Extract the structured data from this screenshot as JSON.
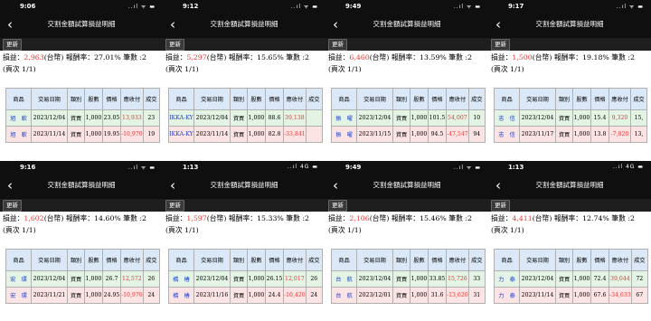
{
  "common": {
    "title": "交割金額試算損益明細",
    "back_icon": "chevron-left-icon",
    "refresh_label": "更新",
    "pl_label": "損益：",
    "ccy_label": "(台幣)",
    "roi_label": " 報酬率：",
    "count_label": " 筆數 :",
    "page_label": "(頁次 1/1)",
    "headers": [
      "商品",
      "交易日期",
      "類別",
      "股數",
      "價格",
      "應收付",
      "成交"
    ]
  },
  "panels": [
    {
      "time": "9:06",
      "signal": "..ıl ᯤ ▬",
      "pl": "2,963",
      "roi": "27.01%",
      "count": "2",
      "rows": [
        {
          "prod": "旭　軟",
          "date": "2023/12/04",
          "type": "資買",
          "qty": "1,000",
          "price": "23.05",
          "amt": "13,933",
          "last": "23"
        },
        {
          "prod": "旭　軟",
          "date": "2023/11/14",
          "type": "資買",
          "qty": "1,000",
          "price": "19.95",
          "amt": "-10,970",
          "last": "19"
        }
      ]
    },
    {
      "time": "9:12",
      "signal": "..ıl ᯤ ▬",
      "pl": "5,297",
      "roi": "15.65%",
      "count": "2",
      "rows": [
        {
          "prod": "IKKA-KY",
          "date": "2023/12/04",
          "type": "資買",
          "qty": "1,000",
          "price": "88.6",
          "amt": "39,138",
          "last": ""
        },
        {
          "prod": "IKKA-KY",
          "date": "2023/11/14",
          "type": "資買",
          "qty": "1,000",
          "price": "82.8",
          "amt": "-33,841",
          "last": ""
        }
      ]
    },
    {
      "time": "9:49",
      "signal": "..ıl ᯤ ▬",
      "pl": "6,460",
      "roi": "13.59%",
      "count": "2",
      "rows": [
        {
          "prod": "振　曜",
          "date": "2023/12/04",
          "type": "資買",
          "qty": "1,000",
          "price": "101.5",
          "amt": "54,007",
          "last": "10"
        },
        {
          "prod": "振　曜",
          "date": "2023/11/15",
          "type": "資買",
          "qty": "1,000",
          "price": "94.5",
          "amt": "-47,547",
          "last": "94"
        }
      ]
    },
    {
      "time": "9:17",
      "signal": "..ıl ᯤ ▬",
      "pl": "1,500",
      "roi": "19.18%",
      "count": "2",
      "rows": [
        {
          "prod": "志　信",
          "date": "2023/12/04",
          "type": "資買",
          "qty": "1,000",
          "price": "15.4",
          "amt": "9,320",
          "last": "15,"
        },
        {
          "prod": "志　信",
          "date": "2023/11/17",
          "type": "資買",
          "qty": "1,000",
          "price": "13.8",
          "amt": "-7,820",
          "last": "13,"
        }
      ]
    },
    {
      "time": "9:16",
      "signal": "..ıl ᯤ ▬",
      "pl": "1,602",
      "roi": "14.60%",
      "count": "2",
      "rows": [
        {
          "prod": "宏　環",
          "date": "2023/12/04",
          "type": "資買",
          "qty": "1,000",
          "price": "26.7",
          "amt": "12,572",
          "last": "26"
        },
        {
          "prod": "宏　環",
          "date": "2023/11/21",
          "type": "資買",
          "qty": "1,000",
          "price": "24.95",
          "amt": "-10,970",
          "last": "24"
        }
      ]
    },
    {
      "time": "1:13",
      "signal": "..ıl 4G ▬",
      "pl": "1,597",
      "roi": "15.33%",
      "count": "2",
      "rows": [
        {
          "prod": "橋　椿",
          "date": "2023/12/04",
          "type": "資買",
          "qty": "1,000",
          "price": "26.15",
          "amt": "12,017",
          "last": "26"
        },
        {
          "prod": "橋　椿",
          "date": "2023/11/16",
          "type": "資買",
          "qty": "1,000",
          "price": "24.4",
          "amt": "-10,420",
          "last": "24"
        }
      ]
    },
    {
      "time": "9:49",
      "signal": "..ıl ᯤ ▬",
      "pl": "2,106",
      "roi": "15.46%",
      "count": "2",
      "rows": [
        {
          "prod": "台　航",
          "date": "2023/12/04",
          "type": "資買",
          "qty": "1,000",
          "price": "33.85",
          "amt": "15,726",
          "last": "33"
        },
        {
          "prod": "台　航",
          "date": "2023/12/01",
          "type": "資買",
          "qty": "1,000",
          "price": "31.6",
          "amt": "-13,620",
          "last": "31"
        }
      ]
    },
    {
      "time": "1:13",
      "signal": "..ıl 4G ▬",
      "pl": "4,411",
      "roi": "12.74%",
      "count": "2",
      "rows": [
        {
          "prod": "力　泰",
          "date": "2023/12/04",
          "type": "資買",
          "qty": "1,000",
          "price": "72.4",
          "amt": "39,044",
          "last": "72"
        },
        {
          "prod": "力　泰",
          "date": "2023/11/14",
          "type": "資買",
          "qty": "1,000",
          "price": "67.6",
          "amt": "-34,633",
          "last": "67"
        }
      ]
    }
  ]
}
